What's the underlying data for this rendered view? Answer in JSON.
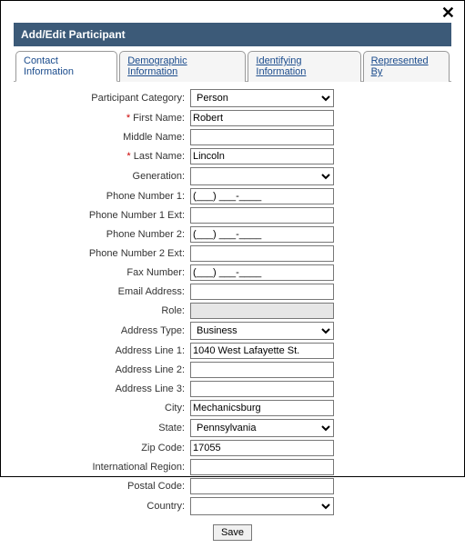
{
  "header": {
    "title": "Add/Edit Participant"
  },
  "tabs": {
    "t0": "Contact Information",
    "t1": "Demographic Information",
    "t2": "Identifying Information",
    "t3": "Represented By"
  },
  "labels": {
    "participant_category": "Participant Category:",
    "first_name": "First Name:",
    "middle_name": "Middle Name:",
    "last_name": "Last Name:",
    "generation": "Generation:",
    "phone1": "Phone Number 1:",
    "phone1ext": "Phone Number 1 Ext:",
    "phone2": "Phone Number 2:",
    "phone2ext": "Phone Number 2 Ext:",
    "fax": "Fax Number:",
    "email": "Email Address:",
    "role": "Role:",
    "address_type": "Address Type:",
    "addr1": "Address Line 1:",
    "addr2": "Address Line 2:",
    "addr3": "Address Line 3:",
    "city": "City:",
    "state": "State:",
    "zip": "Zip Code:",
    "intl_region": "International Region:",
    "postal": "Postal Code:",
    "country": "Country:"
  },
  "values": {
    "participant_category": "Person",
    "first_name": "Robert",
    "middle_name": "",
    "last_name": "Lincoln",
    "generation": "",
    "phone1": "(___) ___-____",
    "phone1ext": "",
    "phone2": "(___) ___-____",
    "phone2ext": "",
    "fax": "(___) ___-____",
    "email": "",
    "address_type": "Business",
    "addr1": "1040 West Lafayette St.",
    "addr2": "",
    "addr3": "",
    "city": "Mechanicsburg",
    "state": "Pennsylvania",
    "zip": "17055",
    "intl_region": "",
    "postal": "",
    "country": ""
  },
  "buttons": {
    "save": "Save"
  },
  "required_mark": "*"
}
